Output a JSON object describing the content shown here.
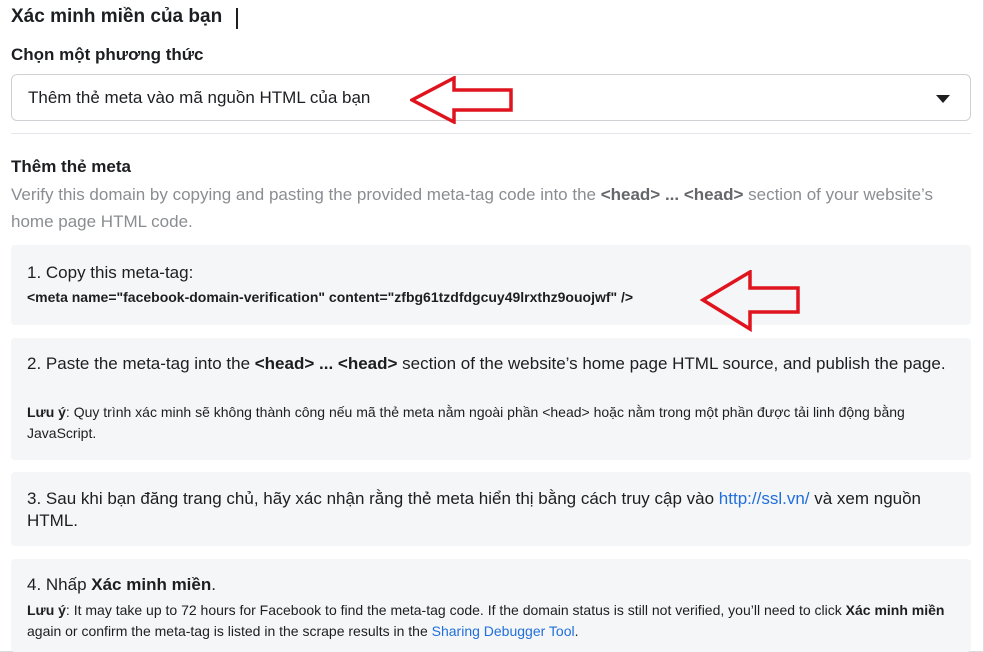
{
  "header": {
    "title": "Xác minh miền của bạn",
    "method_label": "Chọn một phương thức",
    "method_select_value": "Thêm thẻ meta vào mã nguồn HTML của bạn"
  },
  "section": {
    "title": "Thêm thẻ meta",
    "desc_before": "Verify this domain by copying and pasting the provided meta-tag code into the ",
    "desc_tag": "<head> ... <head>",
    "desc_after": " section of your website’s home page HTML code."
  },
  "steps": {
    "step1": {
      "label": "1. Copy this meta-tag:",
      "code": "<meta name=\"facebook-domain-verification\" content=\"zfbg61tzdfdgcuy49lrxthz9ouojwf\" />"
    },
    "step2": {
      "text_before": "2. Paste the meta-tag into the ",
      "text_tag": "<head> ... <head>",
      "text_after": " section of the website’s home page HTML source, and publish the page.",
      "note_label": "Lưu ý",
      "note_text": ": Quy trình xác minh sẽ không thành công nếu mã thẻ meta nằm ngoài phần <head> hoặc nằm trong một phần được tải linh động bằng JavaScript."
    },
    "step3": {
      "text_before": "3. Sau khi bạn đăng trang chủ, hãy xác nhận rằng thẻ meta hiển thị bằng cách truy cập vào ",
      "link": "http://ssl.vn/",
      "text_after": " và xem nguồn HTML."
    },
    "step4": {
      "text_before": "4. Nhấp ",
      "text_bold": "Xác minh miền",
      "text_after": ".",
      "note_label": "Lưu ý",
      "note_text1": ": It may take up to 72 hours for Facebook to find the meta-tag code. If the domain status is still not verified, you’ll need to click ",
      "note_bold": "Xác minh miền",
      "note_text2": " again or confirm the meta-tag is listed in the scrape results in the ",
      "note_link": "Sharing Debugger Tool",
      "note_text3": "."
    }
  },
  "colors": {
    "annotation_arrow": "#e0141e",
    "link": "#216fdb",
    "card_bg": "#f5f6f7"
  }
}
